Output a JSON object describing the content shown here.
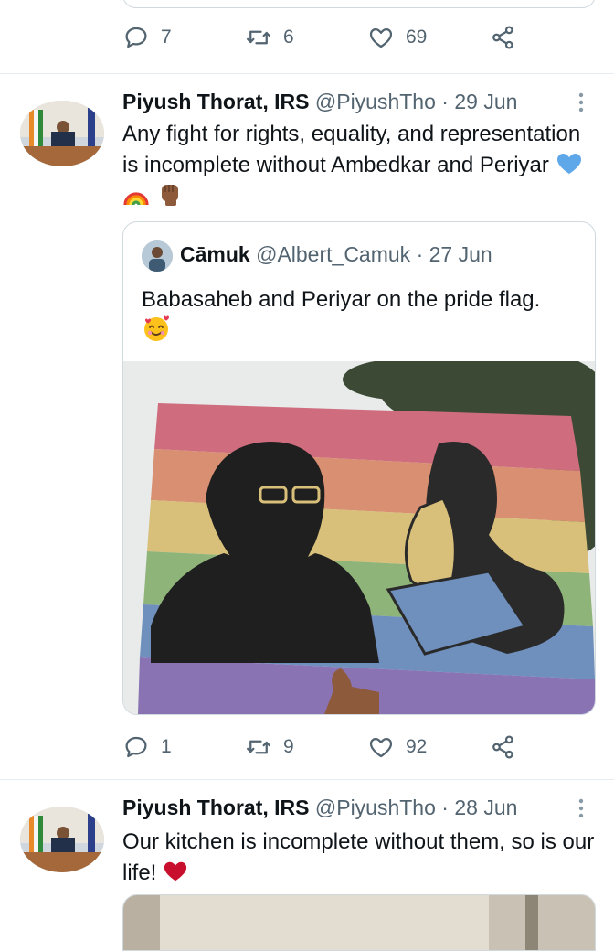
{
  "top_actions": {
    "reply_count": "7",
    "retweet_count": "6",
    "like_count": "69"
  },
  "tweet1": {
    "name": "Piyush Thorat, IRS",
    "handle": "@PiyushTho",
    "date": "29 Jun",
    "text": "Any fight for rights, equality, and representation is incomplete without Ambedkar and Periyar",
    "emojis": [
      "blue-heart-icon",
      "rainbow-icon",
      "raised-fist-icon"
    ],
    "quote": {
      "name": "Cāmuk",
      "handle": "@Albert_Camuk",
      "date": "27 Jun",
      "text": "Babasaheb and Periyar on the pride flag.",
      "emoji": "smiling-face-with-hearts-icon"
    },
    "actions": {
      "reply_count": "1",
      "retweet_count": "9",
      "like_count": "92"
    }
  },
  "tweet2": {
    "name": "Piyush Thorat, IRS",
    "handle": "@PiyushTho",
    "date": "28 Jun",
    "text": "Our kitchen is incomplete without them, so is our life!",
    "emoji": "red-heart-icon"
  },
  "colors": {
    "text": "#0f1419",
    "muted": "#536471",
    "border": "#cfd9de",
    "rainbow": [
      "#cf6d7f",
      "#d98f72",
      "#d8c07a",
      "#8fb479",
      "#6f8fbd",
      "#8a73b3"
    ]
  }
}
